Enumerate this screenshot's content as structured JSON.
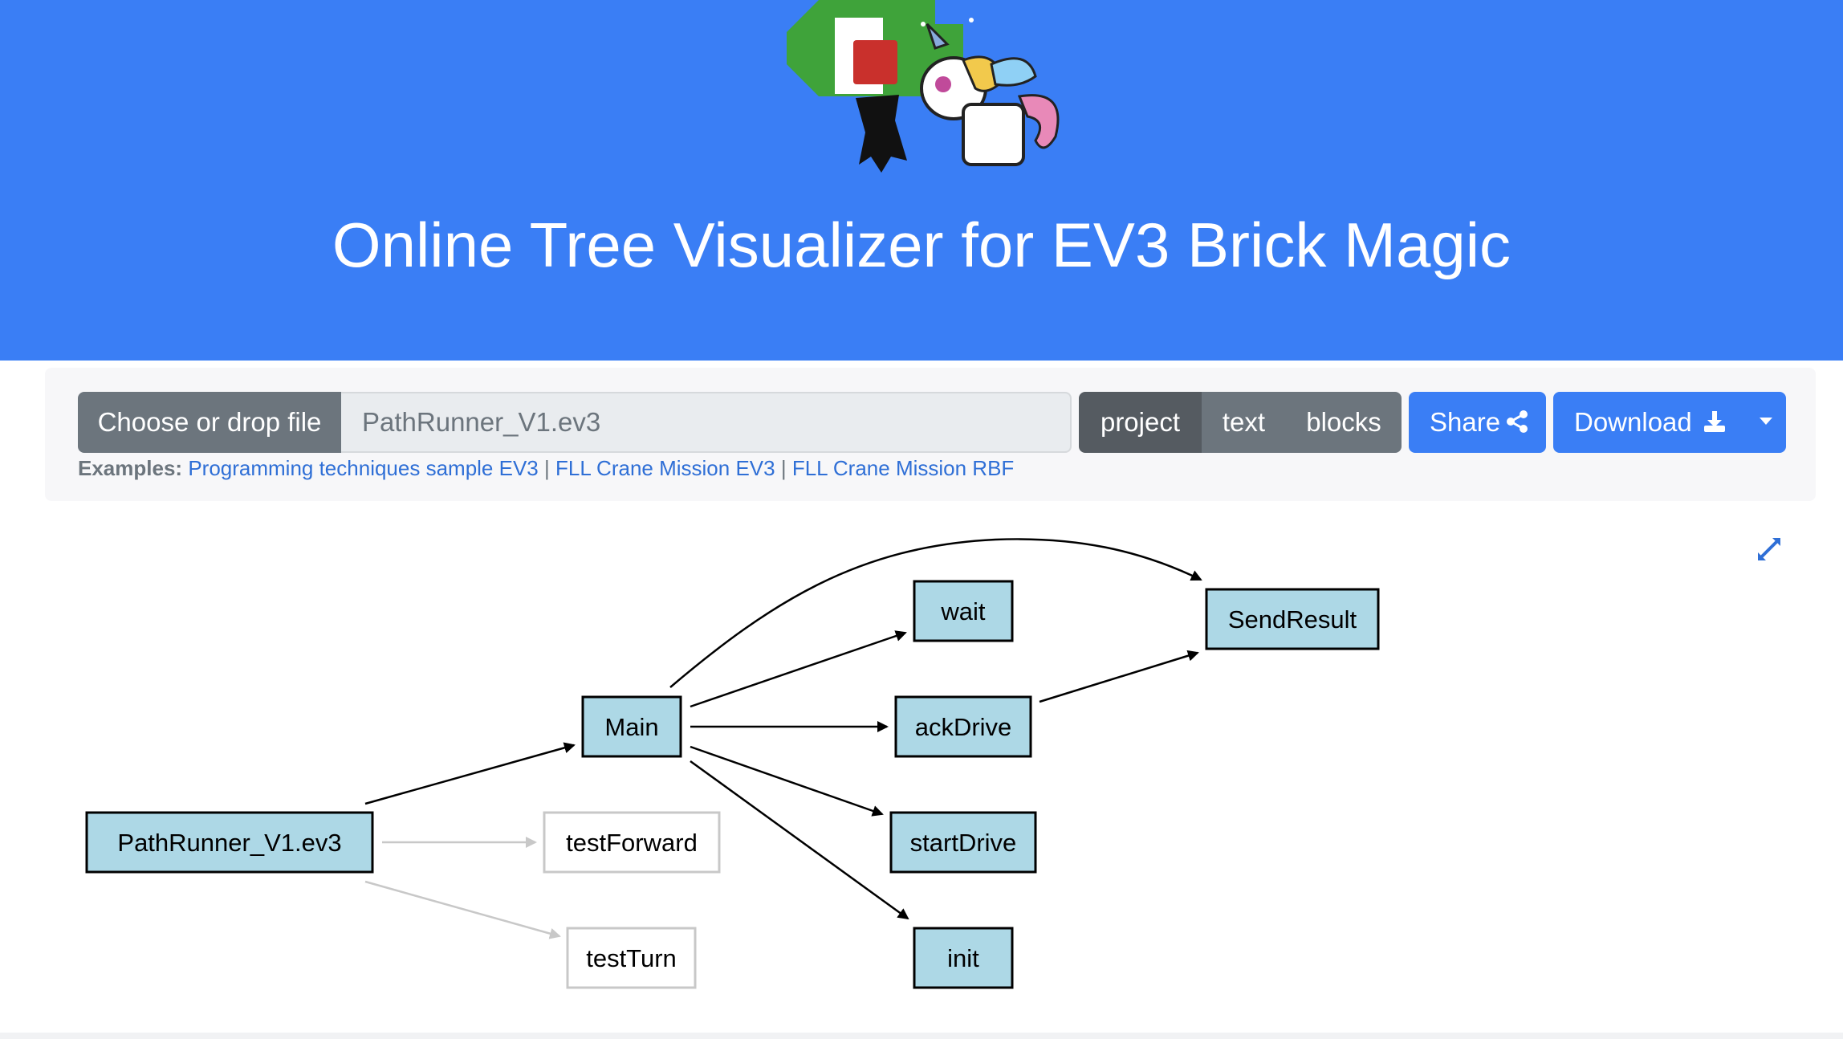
{
  "header": {
    "title": "Online Tree Visualizer for EV3 Brick Magic",
    "background_color": "#3a7ef5"
  },
  "toolbar": {
    "file_button_label": "Choose or drop file",
    "file_name": "PathRunner_V1.ev3",
    "view_tabs": [
      {
        "label": "project",
        "active": true
      },
      {
        "label": "text",
        "active": false
      },
      {
        "label": "blocks",
        "active": false
      }
    ],
    "share_label": "Share",
    "download_label": "Download"
  },
  "examples": {
    "label": "Examples:",
    "links": [
      "Programming techniques sample EV3",
      "FLL Crane Mission EV3",
      "FLL Crane Mission RBF"
    ],
    "separator": "|"
  },
  "graph": {
    "nodes": [
      {
        "id": "PathRunner_V1.ev3",
        "label": "PathRunner_V1.ev3",
        "style": "filled"
      },
      {
        "id": "Main",
        "label": "Main",
        "style": "filled"
      },
      {
        "id": "testForward",
        "label": "testForward",
        "style": "outline"
      },
      {
        "id": "testTurn",
        "label": "testTurn",
        "style": "outline"
      },
      {
        "id": "wait",
        "label": "wait",
        "style": "filled"
      },
      {
        "id": "ackDrive",
        "label": "ackDrive",
        "style": "filled"
      },
      {
        "id": "startDrive",
        "label": "startDrive",
        "style": "filled"
      },
      {
        "id": "init",
        "label": "init",
        "style": "filled"
      },
      {
        "id": "SendResult",
        "label": "SendResult",
        "style": "filled"
      }
    ],
    "edges": [
      {
        "from": "PathRunner_V1.ev3",
        "to": "Main",
        "style": "solid"
      },
      {
        "from": "PathRunner_V1.ev3",
        "to": "testForward",
        "style": "faded"
      },
      {
        "from": "PathRunner_V1.ev3",
        "to": "testTurn",
        "style": "faded"
      },
      {
        "from": "Main",
        "to": "wait",
        "style": "solid"
      },
      {
        "from": "Main",
        "to": "ackDrive",
        "style": "solid"
      },
      {
        "from": "Main",
        "to": "startDrive",
        "style": "solid"
      },
      {
        "from": "Main",
        "to": "init",
        "style": "solid"
      },
      {
        "from": "Main",
        "to": "SendResult",
        "style": "solid"
      },
      {
        "from": "ackDrive",
        "to": "SendResult",
        "style": "solid"
      }
    ],
    "node_fill_color": "#add8e6"
  }
}
